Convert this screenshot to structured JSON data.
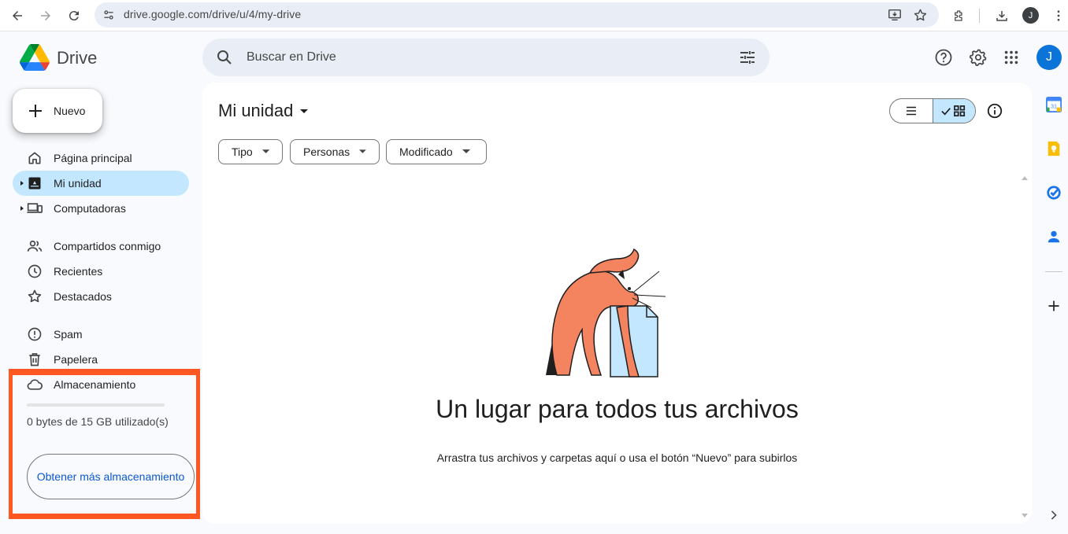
{
  "browser": {
    "url": "drive.google.com/drive/u/4/my-drive",
    "profile_initial": "J"
  },
  "header": {
    "brand": "Drive",
    "search_placeholder": "Buscar en Drive",
    "avatar_initial": "J"
  },
  "sidebar": {
    "new_label": "Nuevo",
    "items": [
      {
        "label": "Página principal",
        "icon": "home-icon"
      },
      {
        "label": "Mi unidad",
        "icon": "my-drive-icon",
        "active": true
      },
      {
        "label": "Computadoras",
        "icon": "computers-icon"
      },
      {
        "label": "Compartidos conmigo",
        "icon": "shared-icon"
      },
      {
        "label": "Recientes",
        "icon": "clock-icon"
      },
      {
        "label": "Destacados",
        "icon": "star-icon"
      },
      {
        "label": "Spam",
        "icon": "spam-icon"
      },
      {
        "label": "Papelera",
        "icon": "trash-icon"
      },
      {
        "label": "Almacenamiento",
        "icon": "cloud-icon"
      }
    ],
    "storage_used": "0 bytes de 15 GB utilizado(s)",
    "storage_button": "Obtener más almacenamiento"
  },
  "main": {
    "title": "Mi unidad",
    "filters": [
      "Tipo",
      "Personas",
      "Modificado"
    ],
    "empty_title": "Un lugar para todos tus archivos",
    "empty_subtitle": "Arrastra tus archivos y carpetas aquí o usa el botón “Nuevo” para subirlos"
  },
  "colors": {
    "accent": "#0b57d0",
    "active_bg": "#c2e7ff",
    "highlight": "#ff5722",
    "cat": "#f4845f"
  }
}
